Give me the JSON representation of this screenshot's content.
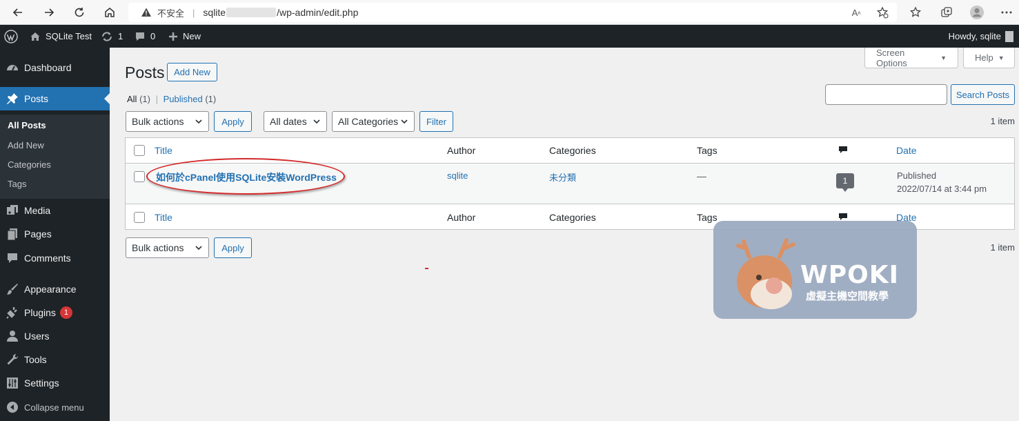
{
  "browser": {
    "insecure_label": "不安全",
    "url_prefix": "sqlite",
    "url_suffix": "/wp-admin/edit.php"
  },
  "adminbar": {
    "site_name": "SQLite Test",
    "updates_count": "1",
    "comments_count": "0",
    "new_label": "New",
    "howdy": "Howdy, sqlite"
  },
  "sidebar": {
    "dashboard": "Dashboard",
    "posts": "Posts",
    "posts_sub": [
      "All Posts",
      "Add New",
      "Categories",
      "Tags"
    ],
    "media": "Media",
    "pages": "Pages",
    "comments": "Comments",
    "appearance": "Appearance",
    "plugins": "Plugins",
    "plugins_badge": "1",
    "users": "Users",
    "tools": "Tools",
    "settings": "Settings",
    "collapse": "Collapse menu"
  },
  "header": {
    "screen_options": "Screen Options",
    "help": "Help",
    "title": "Posts",
    "add_new": "Add New"
  },
  "filters": {
    "all_label": "All",
    "all_count": "(1)",
    "separator": "|",
    "published_label": "Published",
    "published_count": "(1)",
    "search_placeholder": "",
    "search_button": "Search Posts",
    "bulk_actions": "Bulk actions",
    "apply": "Apply",
    "all_dates": "All dates",
    "all_categories": "All Categories",
    "filter": "Filter",
    "item_count": "1 item"
  },
  "table": {
    "columns": {
      "title": "Title",
      "author": "Author",
      "categories": "Categories",
      "tags": "Tags",
      "date": "Date"
    },
    "rows": [
      {
        "title": "如何於cPanel使用SQLite安裝WordPress",
        "author": "sqlite",
        "category": "未分類",
        "tags": "—",
        "comments": "1",
        "status": "Published",
        "date": "2022/07/14 at 3:44 pm"
      }
    ]
  },
  "watermark": {
    "title": "WPOKI",
    "subtitle": "虛擬主機空間教學"
  },
  "colors": {
    "wp_blue": "#2271b1",
    "admin_dark": "#1d2327",
    "badge_red": "#d63638",
    "annotation_red": "#d42a2a"
  }
}
